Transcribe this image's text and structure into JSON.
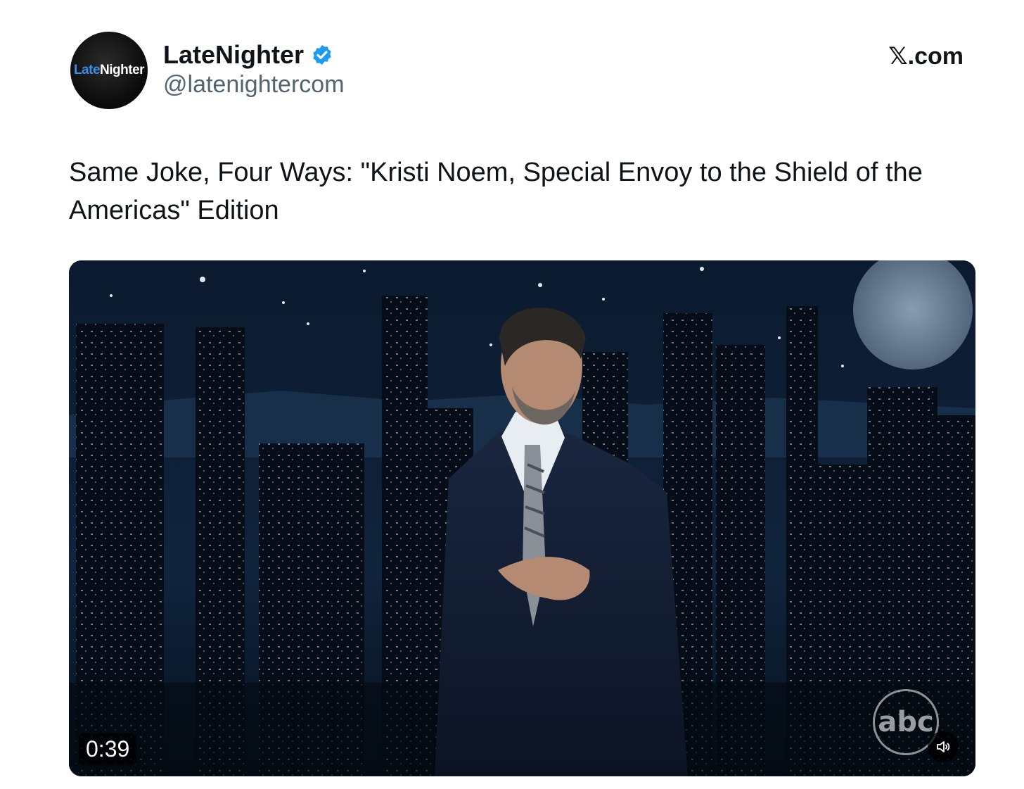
{
  "author": {
    "avatar_logo_part1": "Late",
    "avatar_logo_part2": "Nighter",
    "display_name": "LateNighter",
    "handle": "@latenightercom",
    "verified": true
  },
  "source": {
    "label": "𝕏.com"
  },
  "tweet": {
    "text": "Same Joke, Four Ways: \"Kristi Noem, Special Envoy to the Shield of the Americas\" Edition"
  },
  "video": {
    "duration": "0:39",
    "network_logo_text": "abc",
    "mute_icon": "speaker-icon"
  },
  "colors": {
    "verified_blue": "#1d9bf0",
    "logo_blue": "#3a8ee6",
    "handle_gray": "#536471"
  }
}
